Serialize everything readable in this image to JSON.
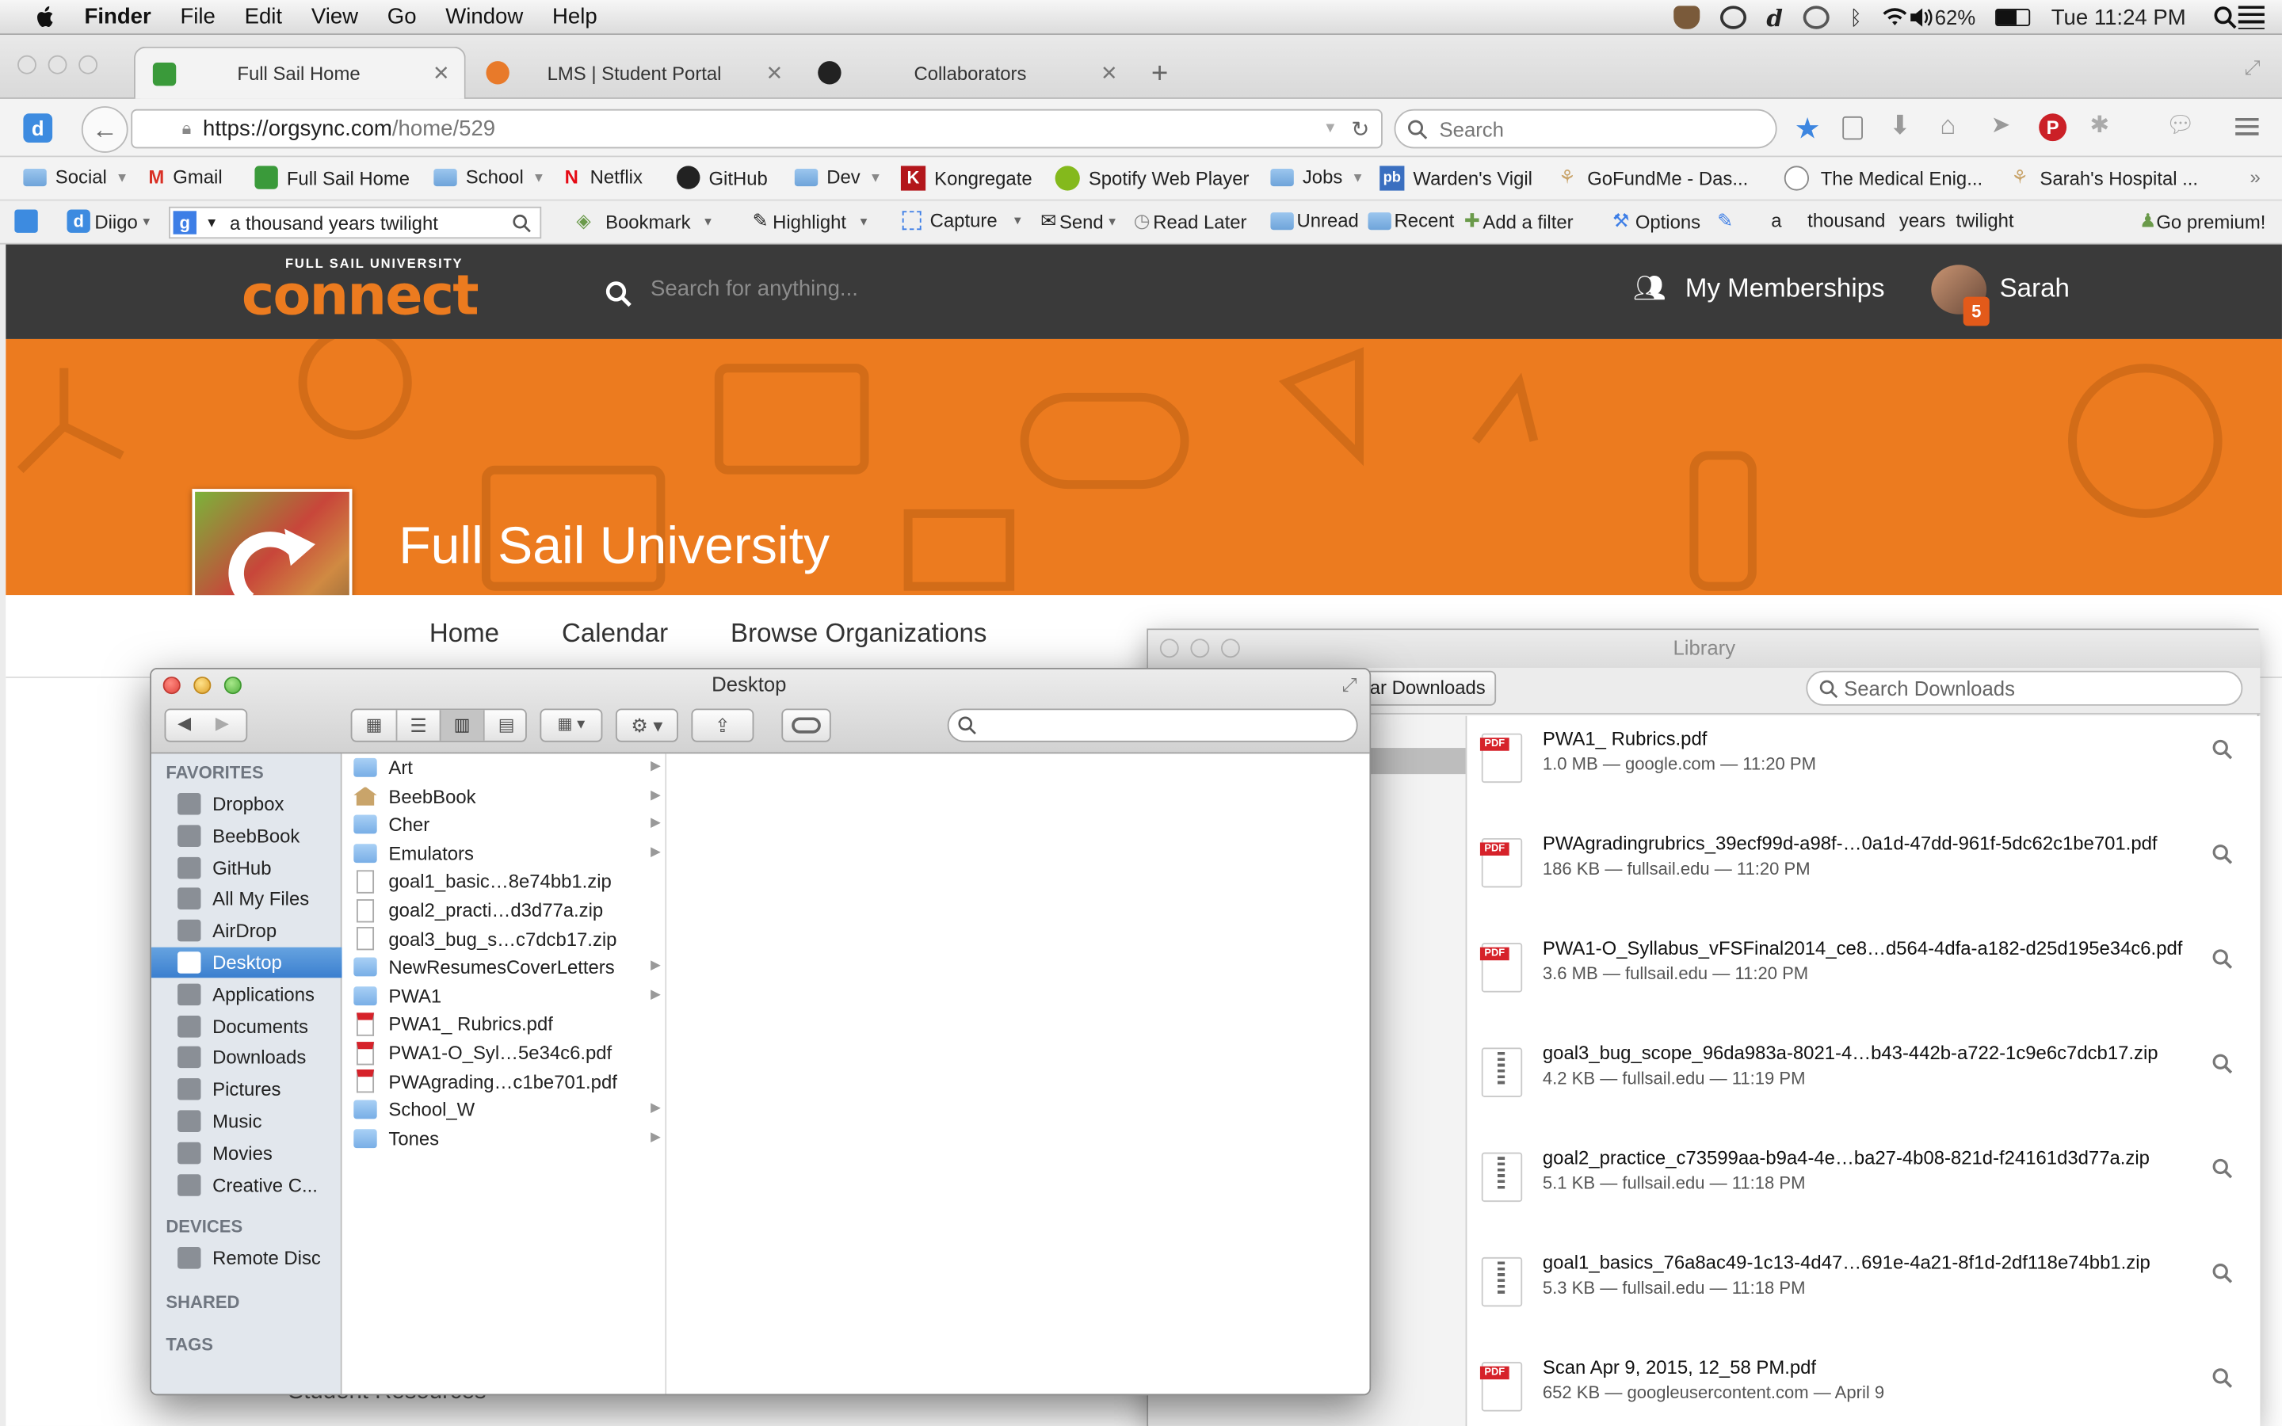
{
  "menubar": {
    "app": "Finder",
    "items": [
      "File",
      "Edit",
      "View",
      "Go",
      "Window",
      "Help"
    ],
    "battery": "62%",
    "clock": "Tue 11:24 PM"
  },
  "tabs": [
    {
      "label": "Full Sail Home",
      "active": true,
      "color": "#3a9a3a"
    },
    {
      "label": "LMS | Student Portal",
      "active": false,
      "color": "#e87a2a"
    },
    {
      "label": "Collaborators",
      "active": false,
      "color": "#222222"
    }
  ],
  "nav": {
    "url_host": "https://orgsync.com",
    "url_path": "/home/529",
    "search_placeholder": "Search"
  },
  "bookmarks": [
    "Social",
    "Gmail",
    "Full Sail Home",
    "School",
    "Netflix",
    "GitHub",
    "Dev",
    "Kongregate",
    "Spotify Web Player",
    "Jobs",
    "Warden's Vigil",
    "GoFundMe - Das...",
    "The Medical Enig...",
    "Sarah's Hospital ..."
  ],
  "diigo": {
    "brand": "Diigo",
    "search_value": "a thousand years twilight",
    "tools": [
      "Bookmark",
      "Highlight",
      "Capture",
      "Send",
      "Read Later",
      "Unread",
      "Recent",
      "Add a filter",
      "Options"
    ],
    "words": [
      "a",
      "thousand",
      "years",
      "twilight"
    ],
    "premium": "Go premium!"
  },
  "site": {
    "logo_small": "FULL SAIL UNIVERSITY",
    "logo_big": "connect",
    "search_placeholder": "Search for anything...",
    "memberships": "My Memberships",
    "user": "Sarah",
    "notifications": "5",
    "org_name": "Full Sail University",
    "org_nav": [
      "Home",
      "Calendar",
      "Browse Organizations"
    ],
    "footer_partial": "Student Resources",
    "accent": "#ec7b1f"
  },
  "library": {
    "title": "Library",
    "clear_btn": "ear Downloads",
    "search_placeholder": "Search Downloads",
    "downloads": [
      {
        "name": "PWA1_ Rubrics.pdf",
        "meta": "1.0 MB — google.com — 11:20 PM",
        "type": "pdf"
      },
      {
        "name": "PWAgradingrubrics_39ecf99d-a98f-…0a1d-47dd-961f-5dc62c1be701.pdf",
        "meta": "186 KB — fullsail.edu — 11:20 PM",
        "type": "pdf"
      },
      {
        "name": "PWA1-O_Syllabus_vFSFinal2014_ce8…d564-4dfa-a182-d25d195e34c6.pdf",
        "meta": "3.6 MB — fullsail.edu — 11:20 PM",
        "type": "pdf"
      },
      {
        "name": "goal3_bug_scope_96da983a-8021-4…b43-442b-a722-1c9e6c7dcb17.zip",
        "meta": "4.2 KB — fullsail.edu — 11:19 PM",
        "type": "zip"
      },
      {
        "name": "goal2_practice_c73599aa-b9a4-4e…ba27-4b08-821d-f24161d3d77a.zip",
        "meta": "5.1 KB — fullsail.edu — 11:18 PM",
        "type": "zip"
      },
      {
        "name": "goal1_basics_76a8ac49-1c13-4d47…691e-4a21-8f1d-2df118e74bb1.zip",
        "meta": "5.3 KB — fullsail.edu — 11:18 PM",
        "type": "zip"
      },
      {
        "name": "Scan Apr 9, 2015, 12_58 PM.pdf",
        "meta": "652 KB — googleusercontent.com — April 9",
        "type": "pdf"
      }
    ]
  },
  "finder": {
    "title": "Desktop",
    "sections": {
      "favorites": "FAVORITES",
      "devices": "DEVICES",
      "shared": "SHARED",
      "tags": "TAGS"
    },
    "favorites": [
      "Dropbox",
      "BeebBook",
      "GitHub",
      "All My Files",
      "AirDrop",
      "Desktop",
      "Applications",
      "Documents",
      "Downloads",
      "Pictures",
      "Music",
      "Movies",
      "Creative C..."
    ],
    "selected": "Desktop",
    "devices": [
      "Remote Disc"
    ],
    "items": [
      {
        "name": "Art",
        "kind": "folder"
      },
      {
        "name": "BeebBook",
        "kind": "home"
      },
      {
        "name": "Cher",
        "kind": "folder"
      },
      {
        "name": "Emulators",
        "kind": "folder"
      },
      {
        "name": "goal1_basic…8e74bb1.zip",
        "kind": "zip"
      },
      {
        "name": "goal2_practi…d3d77a.zip",
        "kind": "zip"
      },
      {
        "name": "goal3_bug_s…c7dcb17.zip",
        "kind": "zip"
      },
      {
        "name": "NewResumesCoverLetters",
        "kind": "folder"
      },
      {
        "name": "PWA1",
        "kind": "folder"
      },
      {
        "name": "PWA1_ Rubrics.pdf",
        "kind": "pdf"
      },
      {
        "name": "PWA1-O_Syl…5e34c6.pdf",
        "kind": "pdf"
      },
      {
        "name": "PWAgrading…c1be701.pdf",
        "kind": "pdf"
      },
      {
        "name": "School_W",
        "kind": "folder"
      },
      {
        "name": "Tones",
        "kind": "folder"
      }
    ]
  }
}
